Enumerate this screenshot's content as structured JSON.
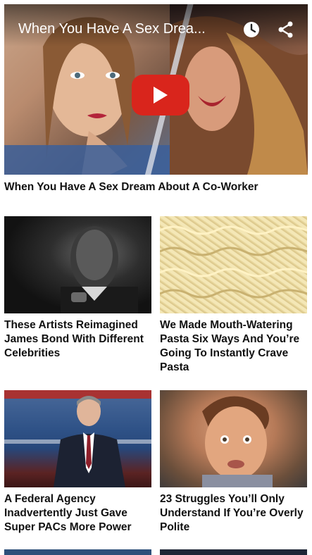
{
  "hero": {
    "video_title": "When You Have A Sex Drea...",
    "caption": "When You Have A Sex Dream About A Co-Worker",
    "play_icon": "play-icon",
    "clock_icon": "clock-icon",
    "share_icon": "share-icon",
    "play_color": "#d9251c"
  },
  "cards": [
    {
      "title": "These Artists Reimagined James Bond With Different Celebrities",
      "image": "James Bond portrait"
    },
    {
      "title": "We Made Mouth-Watering Pasta Six Ways And You’re Going To Instantly Crave Pasta",
      "image": "pasta noodles"
    },
    {
      "title": "A Federal Agency Inadvertently Just Gave Super PACs More Power",
      "image": "politician at podium"
    },
    {
      "title": "23 Struggles You’ll Only Understand If You’re Overly Polite",
      "image": "man making a face"
    }
  ]
}
